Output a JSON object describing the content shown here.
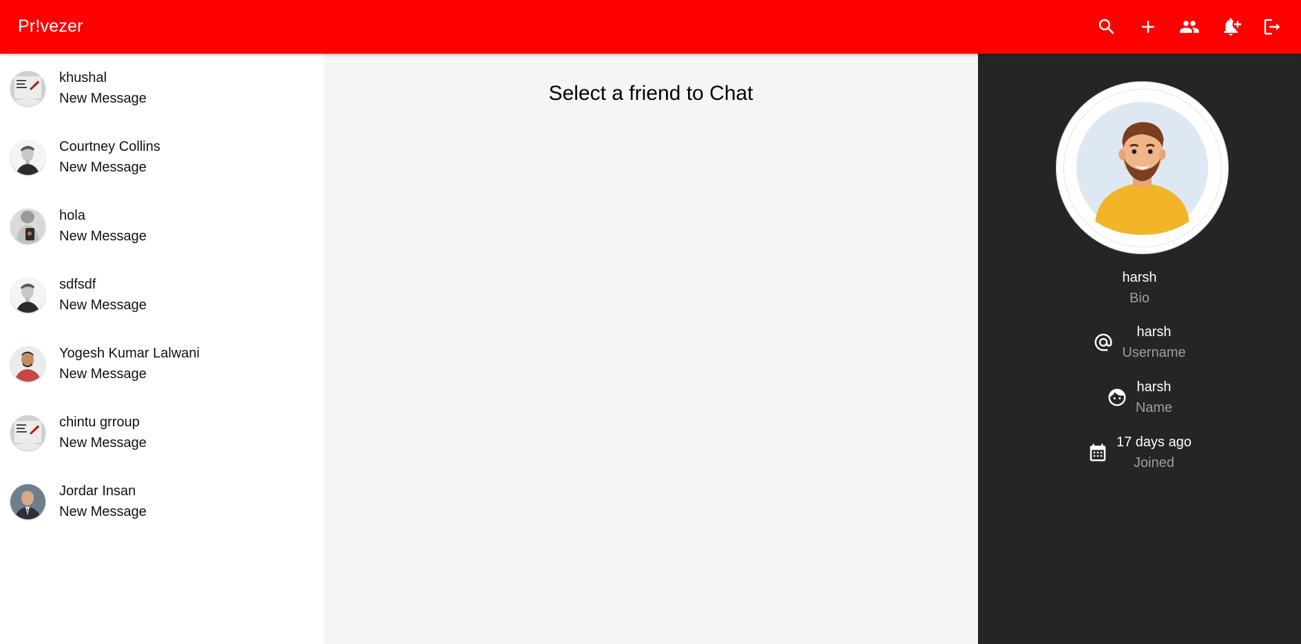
{
  "appbar": {
    "brand": "Pr!vezer",
    "actions": [
      {
        "icon": "search-icon"
      },
      {
        "icon": "add-icon"
      },
      {
        "icon": "people-icon"
      },
      {
        "icon": "notification-add-icon"
      },
      {
        "icon": "logout-icon"
      }
    ],
    "background": "#ff0000"
  },
  "sidebar": {
    "friends": [
      {
        "name": "khushal",
        "sub": "New Message",
        "avatar": "poster-avatar"
      },
      {
        "name": "Courtney Collins",
        "sub": "New Message",
        "avatar": "bw-portrait-avatar"
      },
      {
        "name": "hola",
        "sub": "New Message",
        "avatar": "selfie-avatar"
      },
      {
        "name": "sdfsdf",
        "sub": "New Message",
        "avatar": "bw-portrait-avatar"
      },
      {
        "name": "Yogesh Kumar Lalwani",
        "sub": "New Message",
        "avatar": "man-red-shirt-avatar"
      },
      {
        "name": "chintu grroup",
        "sub": "New Message",
        "avatar": "poster-avatar"
      },
      {
        "name": "Jordar Insan",
        "sub": "New Message",
        "avatar": "man-suit-avatar"
      }
    ]
  },
  "main": {
    "title": "Select a friend to Chat",
    "background": "#f5f5f5"
  },
  "profile": {
    "name": "harsh",
    "bio_label": "Bio",
    "username": {
      "value": "harsh",
      "label": "Username",
      "icon": "at-icon"
    },
    "fullname": {
      "value": "harsh",
      "label": "Name",
      "icon": "face-icon"
    },
    "joined": {
      "value": "17 days ago",
      "label": "Joined",
      "icon": "calendar-icon"
    },
    "background": "#252525"
  }
}
